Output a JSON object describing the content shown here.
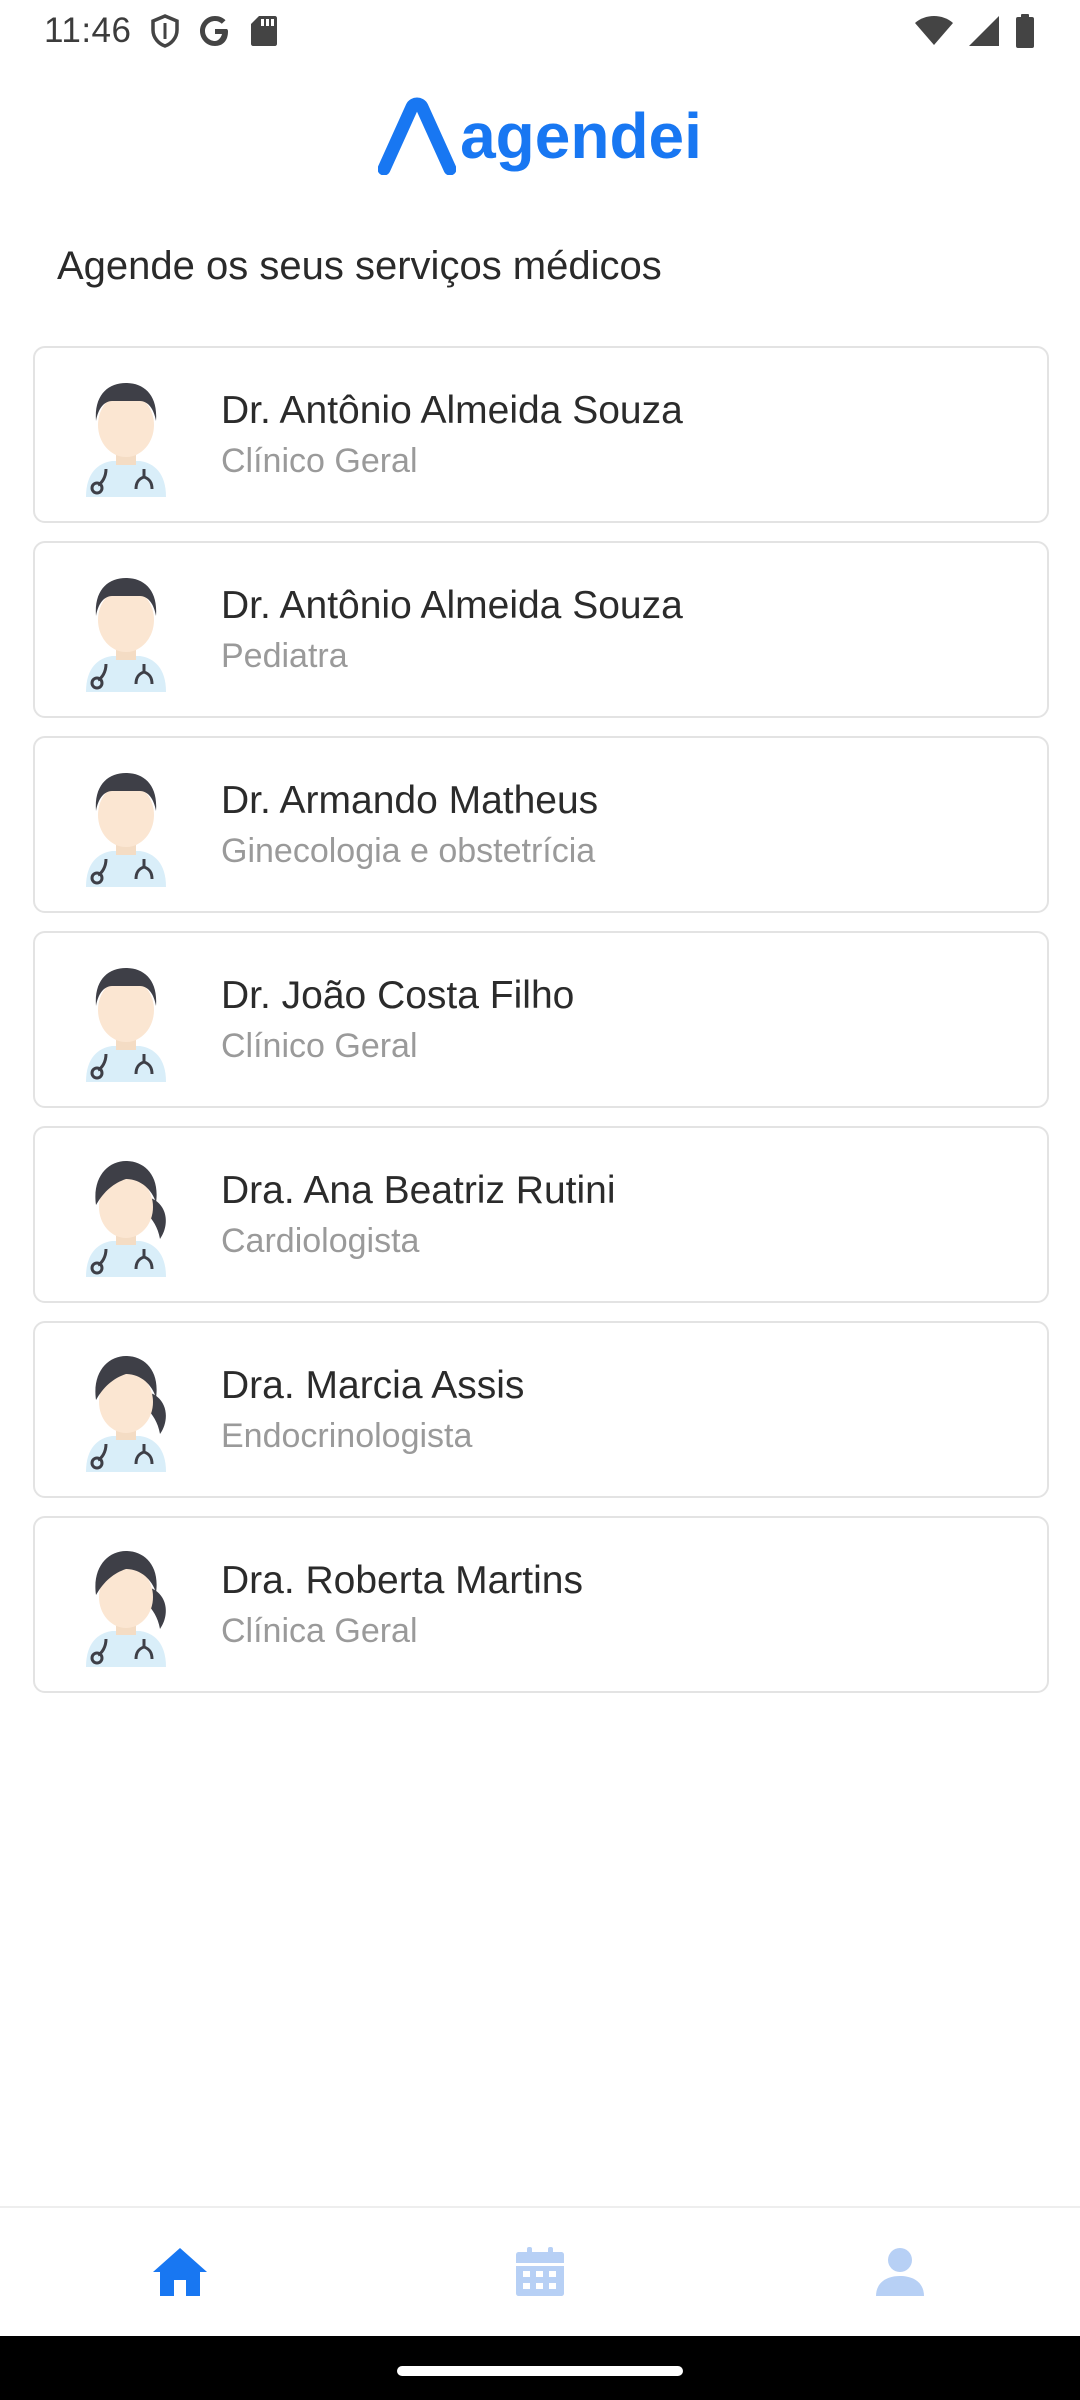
{
  "status_bar": {
    "time": "11:46",
    "icons": [
      "shield-icon",
      "google-icon",
      "sd-card-icon",
      "wifi-icon",
      "signal-icon",
      "battery-icon"
    ]
  },
  "app": {
    "logo_text": "agendei",
    "brand_color": "#1877f2"
  },
  "page": {
    "subtitle": "Agende os seus serviços médicos"
  },
  "doctors": [
    {
      "name": "Dr. Antônio Almeida Souza",
      "specialty": "Clínico Geral",
      "avatar": "male-doctor-icon"
    },
    {
      "name": "Dr. Antônio Almeida Souza",
      "specialty": "Pediatra",
      "avatar": "male-doctor-icon"
    },
    {
      "name": "Dr. Armando Matheus",
      "specialty": "Ginecologia e obstetrícia",
      "avatar": "male-doctor-icon"
    },
    {
      "name": "Dr. João Costa Filho",
      "specialty": "Clínico Geral",
      "avatar": "male-doctor-icon"
    },
    {
      "name": "Dra. Ana Beatriz Rutini",
      "specialty": "Cardiologista",
      "avatar": "female-doctor-icon"
    },
    {
      "name": "Dra. Marcia Assis",
      "specialty": "Endocrinologista",
      "avatar": "female-doctor-icon"
    },
    {
      "name": "Dra. Roberta Martins",
      "specialty": "Clínica Geral",
      "avatar": "female-doctor-icon"
    }
  ],
  "bottom_nav": {
    "items": [
      {
        "icon": "home-icon",
        "active": true
      },
      {
        "icon": "calendar-icon",
        "active": false
      },
      {
        "icon": "profile-icon",
        "active": false
      }
    ],
    "active_color": "#1877f2",
    "inactive_color": "#b7d0f5"
  }
}
